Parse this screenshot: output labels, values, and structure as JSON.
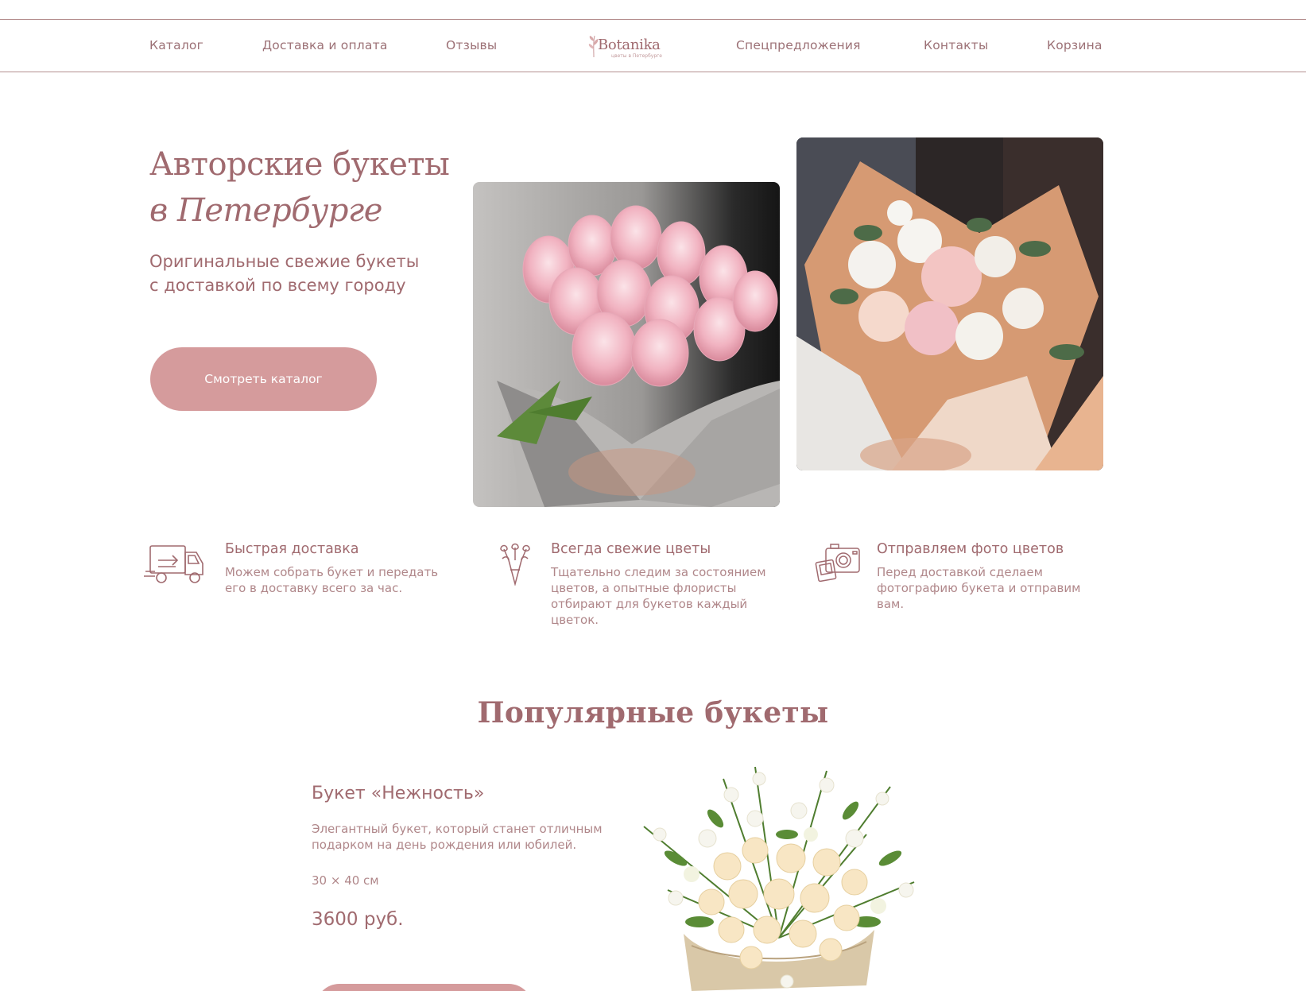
{
  "nav": {
    "catalog": "Каталог",
    "delivery": "Доставка и оплата",
    "reviews": "Отзывы",
    "offers": "Спецпредложения",
    "contacts": "Контакты",
    "cart": "Корзина"
  },
  "logo": {
    "name": "Botanika",
    "tagline": "цветы в Петербурге"
  },
  "hero": {
    "title_line1": "Авторские букеты",
    "title_line2": "в Петербурге",
    "subtitle_line1": "Оригинальные свежие букеты",
    "subtitle_line2": "с доставкой по всему городу",
    "cta_label": "Смотреть каталог"
  },
  "features": [
    {
      "icon": "delivery-truck-icon",
      "title": "Быстрая доставка",
      "lines": [
        "Можем собрать букет и передать",
        "его в доставку всего за час."
      ]
    },
    {
      "icon": "bouquet-icon",
      "title": "Всегда свежие цветы",
      "lines": [
        "Тщательно следим за состоянием",
        "цветов, а опытные флористы",
        "отбирают для букетов каждый",
        "цветок."
      ]
    },
    {
      "icon": "camera-photo-icon",
      "title": "Отправляем фото цветов",
      "lines": [
        "Перед доставкой сделаем",
        "фотографию букета и отправим",
        "вам."
      ]
    }
  ],
  "popular": {
    "title": "Популярные букеты",
    "product": {
      "name": "Букет «Нежность»",
      "desc_line1": "Элегантный букет, который станет отличным",
      "desc_line2": "подарком на день рождения или юбилей.",
      "size": "30 × 40 см",
      "price": "3600 руб."
    }
  },
  "colors": {
    "accent": "#d59b9c",
    "text": "#a06a6f",
    "muted_text": "#b0878a",
    "rule": "#b58f8f"
  }
}
